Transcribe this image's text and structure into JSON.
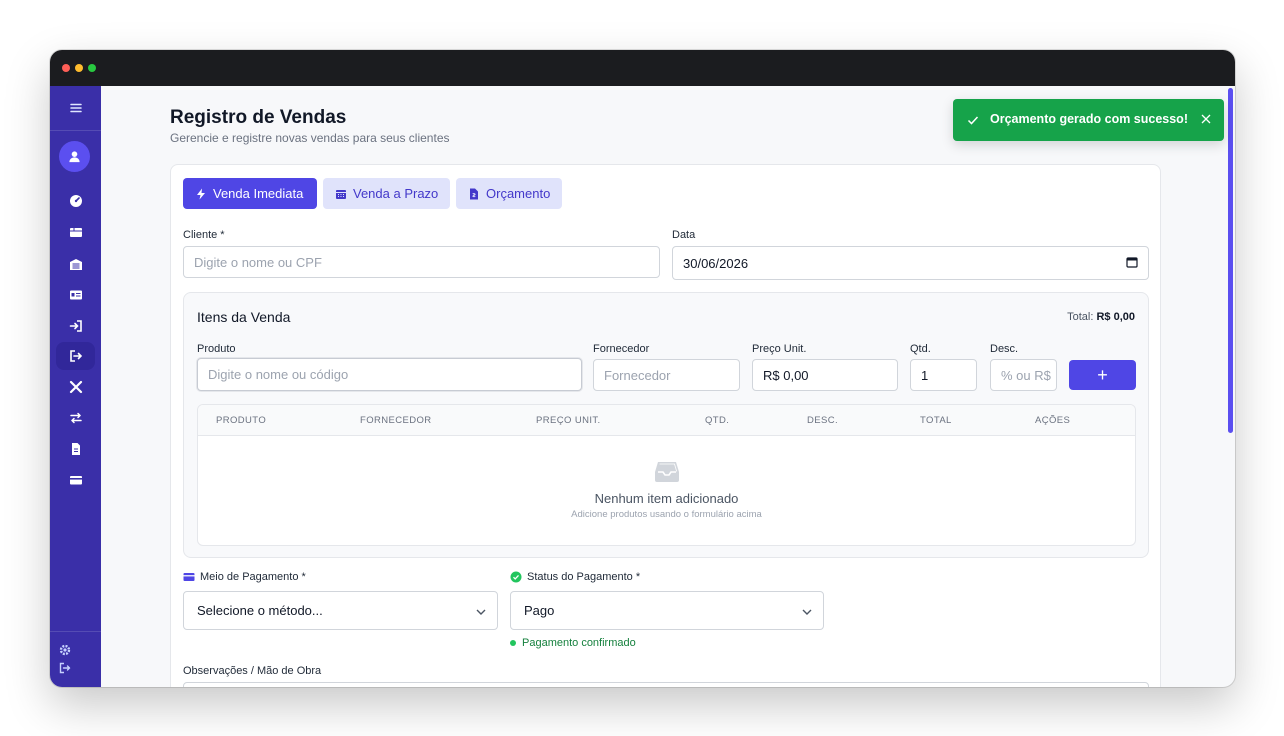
{
  "page": {
    "title": "Registro de Vendas",
    "subtitle": "Gerencie e registre novas vendas para seus clientes"
  },
  "toast": {
    "message": "Orçamento gerado com sucesso!"
  },
  "tabs": [
    {
      "label": "Venda Imediata",
      "icon": "bolt-icon",
      "active": true
    },
    {
      "label": "Venda a Prazo",
      "icon": "calendar-icon",
      "active": false
    },
    {
      "label": "Orçamento",
      "icon": "file-invoice-icon",
      "active": false
    }
  ],
  "form": {
    "cliente_label": "Cliente *",
    "cliente_placeholder": "Digite o nome ou CPF",
    "data_label": "Data",
    "data_value": "30/06/2026"
  },
  "items": {
    "title": "Itens da Venda",
    "total_label": "Total:",
    "total_value": "R$ 0,00",
    "produto_label": "Produto",
    "produto_placeholder": "Digite o nome ou código",
    "fornecedor_label": "Fornecedor",
    "fornecedor_placeholder": "Fornecedor",
    "preco_label": "Preço Unit.",
    "preco_value": "R$ 0,00",
    "qtd_label": "Qtd.",
    "qtd_value": "1",
    "desc_label": "Desc.",
    "desc_placeholder": "% ou R$",
    "add_label": "+",
    "columns": [
      "PRODUTO",
      "FORNECEDOR",
      "PREÇO UNIT.",
      "QTD.",
      "DESC.",
      "TOTAL",
      "AÇÕES"
    ],
    "empty_title": "Nenhum item adicionado",
    "empty_sub": "Adicione produtos usando o formulário acima"
  },
  "payment": {
    "method_label": "Meio de Pagamento *",
    "method_value": "Selecione o método...",
    "status_label": "Status do Pagamento *",
    "status_value": "Pago",
    "status_note": "Pagamento confirmado"
  },
  "obs": {
    "label": "Observações / Mão de Obra"
  },
  "colors": {
    "primary": "#4f46e5",
    "sidebar": "#3a2fa8",
    "success": "#16a34a",
    "tab_secondary_bg": "#e0e3fb"
  },
  "sidebar": {
    "items": [
      "menu-icon",
      "dashboard-icon",
      "boxes-icon",
      "warehouse-icon",
      "id-card-icon",
      "sign-in-icon",
      "sign-out-icon",
      "tools-icon",
      "exchange-icon",
      "document-icon",
      "credit-card-icon"
    ],
    "active": "sign-out-icon",
    "footer": [
      "settings-icon",
      "logout-icon"
    ]
  }
}
